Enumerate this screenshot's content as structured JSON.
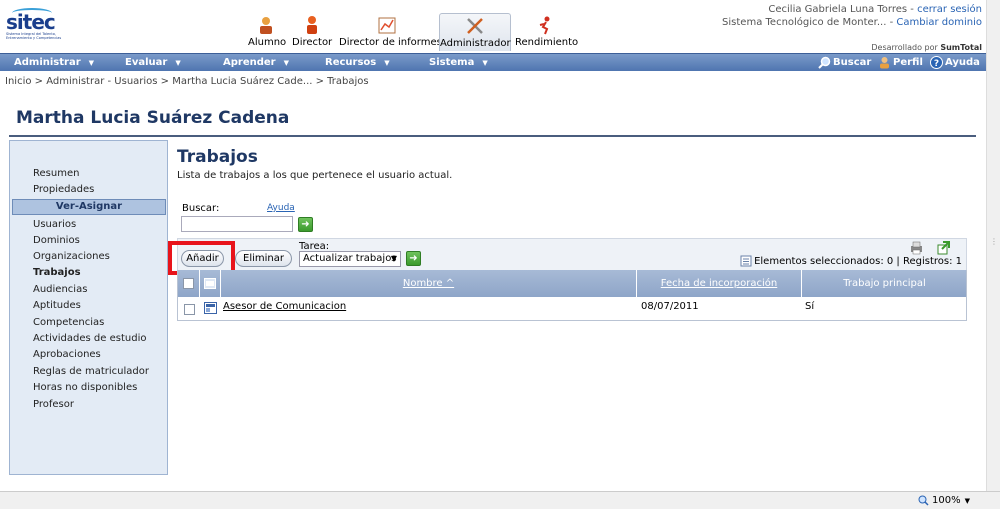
{
  "logo": {
    "text": "sitec",
    "subtitle": "Sistema Integral del Talento, Entrenamiento y Competencias"
  },
  "roles": [
    {
      "label": "Alumno",
      "icon": "student-icon"
    },
    {
      "label": "Director",
      "icon": "director-icon"
    },
    {
      "label": "Director de informes",
      "icon": "reports-chart-icon"
    },
    {
      "label": "Administrador",
      "icon": "tools-icon"
    },
    {
      "label": "Rendimiento",
      "icon": "runner-icon"
    }
  ],
  "user": {
    "name": "Cecilia Gabriela Luna Torres - ",
    "logout": "cerrar sesión",
    "domain": "Sistema Tecnológico de Monter... - ",
    "change_domain": "Cambiar dominio",
    "powered_prefix": "Desarrollado por ",
    "powered_brand": "SumTotal"
  },
  "menu": [
    "Administrar",
    "Evaluar",
    "Aprender",
    "Recursos",
    "Sistema"
  ],
  "right_menu": {
    "search": "Buscar",
    "profile": "Perfil",
    "help": "Ayuda"
  },
  "breadcrumb": "Inicio > Administrar - Usuarios > Martha Lucia Suárez Cade... > Trabajos",
  "page_title": "Martha Lucia Suárez Cadena",
  "nav": {
    "top": [
      "Resumen",
      "Propiedades"
    ],
    "section": "Ver-Asignar",
    "items": [
      "Usuarios",
      "Dominios",
      "Organizaciones",
      "Trabajos",
      "Audiencias",
      "Aptitudes",
      "Competencias",
      "Actividades de estudio",
      "Aprobaciones",
      "Reglas de matriculador",
      "Horas no disponibles",
      "Profesor"
    ]
  },
  "main": {
    "title": "Trabajos",
    "description": "Lista de trabajos a los que pertenece el usuario actual.",
    "search_label": "Buscar:",
    "help_link": "Ayuda",
    "search_value": "",
    "add_button": "Añadir",
    "delete_button": "Eliminar",
    "task_label": "Tarea:",
    "task_selected": "Actualizar trabajos",
    "selected_info": "Elementos seleccionados: 0 | Registros: 1"
  },
  "table": {
    "headers": [
      "Nombre ^",
      "Fecha de incorporación",
      "Trabajo principal"
    ],
    "rows": [
      {
        "name": "Asesor de Comunicacion",
        "date": "08/07/2011",
        "main": "Sí"
      }
    ]
  },
  "status": {
    "zoom": "100%"
  },
  "colors": {
    "accent": "#4f75b0",
    "title": "#1f3864",
    "highlight": "#e8141b",
    "link": "#2a64b4"
  }
}
